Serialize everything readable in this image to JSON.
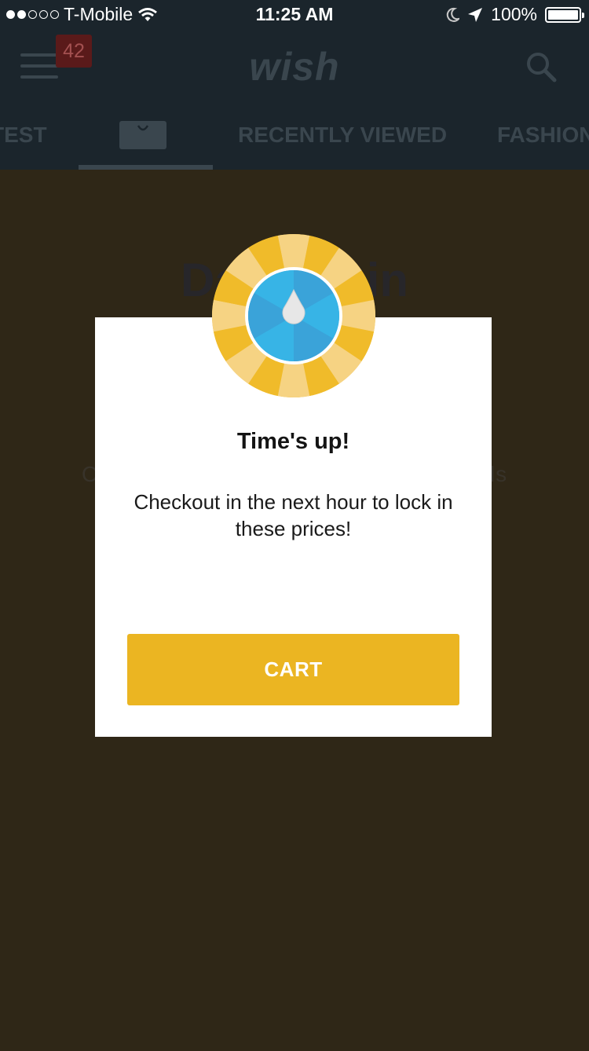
{
  "status_bar": {
    "carrier": "T-Mobile",
    "time": "11:25 AM",
    "battery": "100%",
    "signal_bars_filled": 2,
    "signal_bars_total": 5
  },
  "header": {
    "logo": "wish",
    "notification_count": "42",
    "tabs": [
      {
        "label": "TEST"
      },
      {
        "label": "RECENTLY VIEWED"
      },
      {
        "label": "FASHION"
      }
    ]
  },
  "background": {
    "title": "Daily Spin",
    "subtitle": "Come back tomorrow to spin for rewards"
  },
  "modal": {
    "title": "Time's up!",
    "message": "Checkout in the next hour to lock in these prices!",
    "button_label": "CART"
  },
  "colors": {
    "accent": "#ebb522",
    "header_bg": "#1b252c",
    "overlay_bg": "#2f2717",
    "wheel_blue": "#3aa3d9",
    "wheel_yellow": "#f0bb2a"
  },
  "icons": [
    "wifi-icon",
    "moon-icon",
    "location-icon",
    "battery-icon",
    "menu-icon",
    "search-icon",
    "shopping-bag-icon",
    "spin-wheel-icon"
  ]
}
